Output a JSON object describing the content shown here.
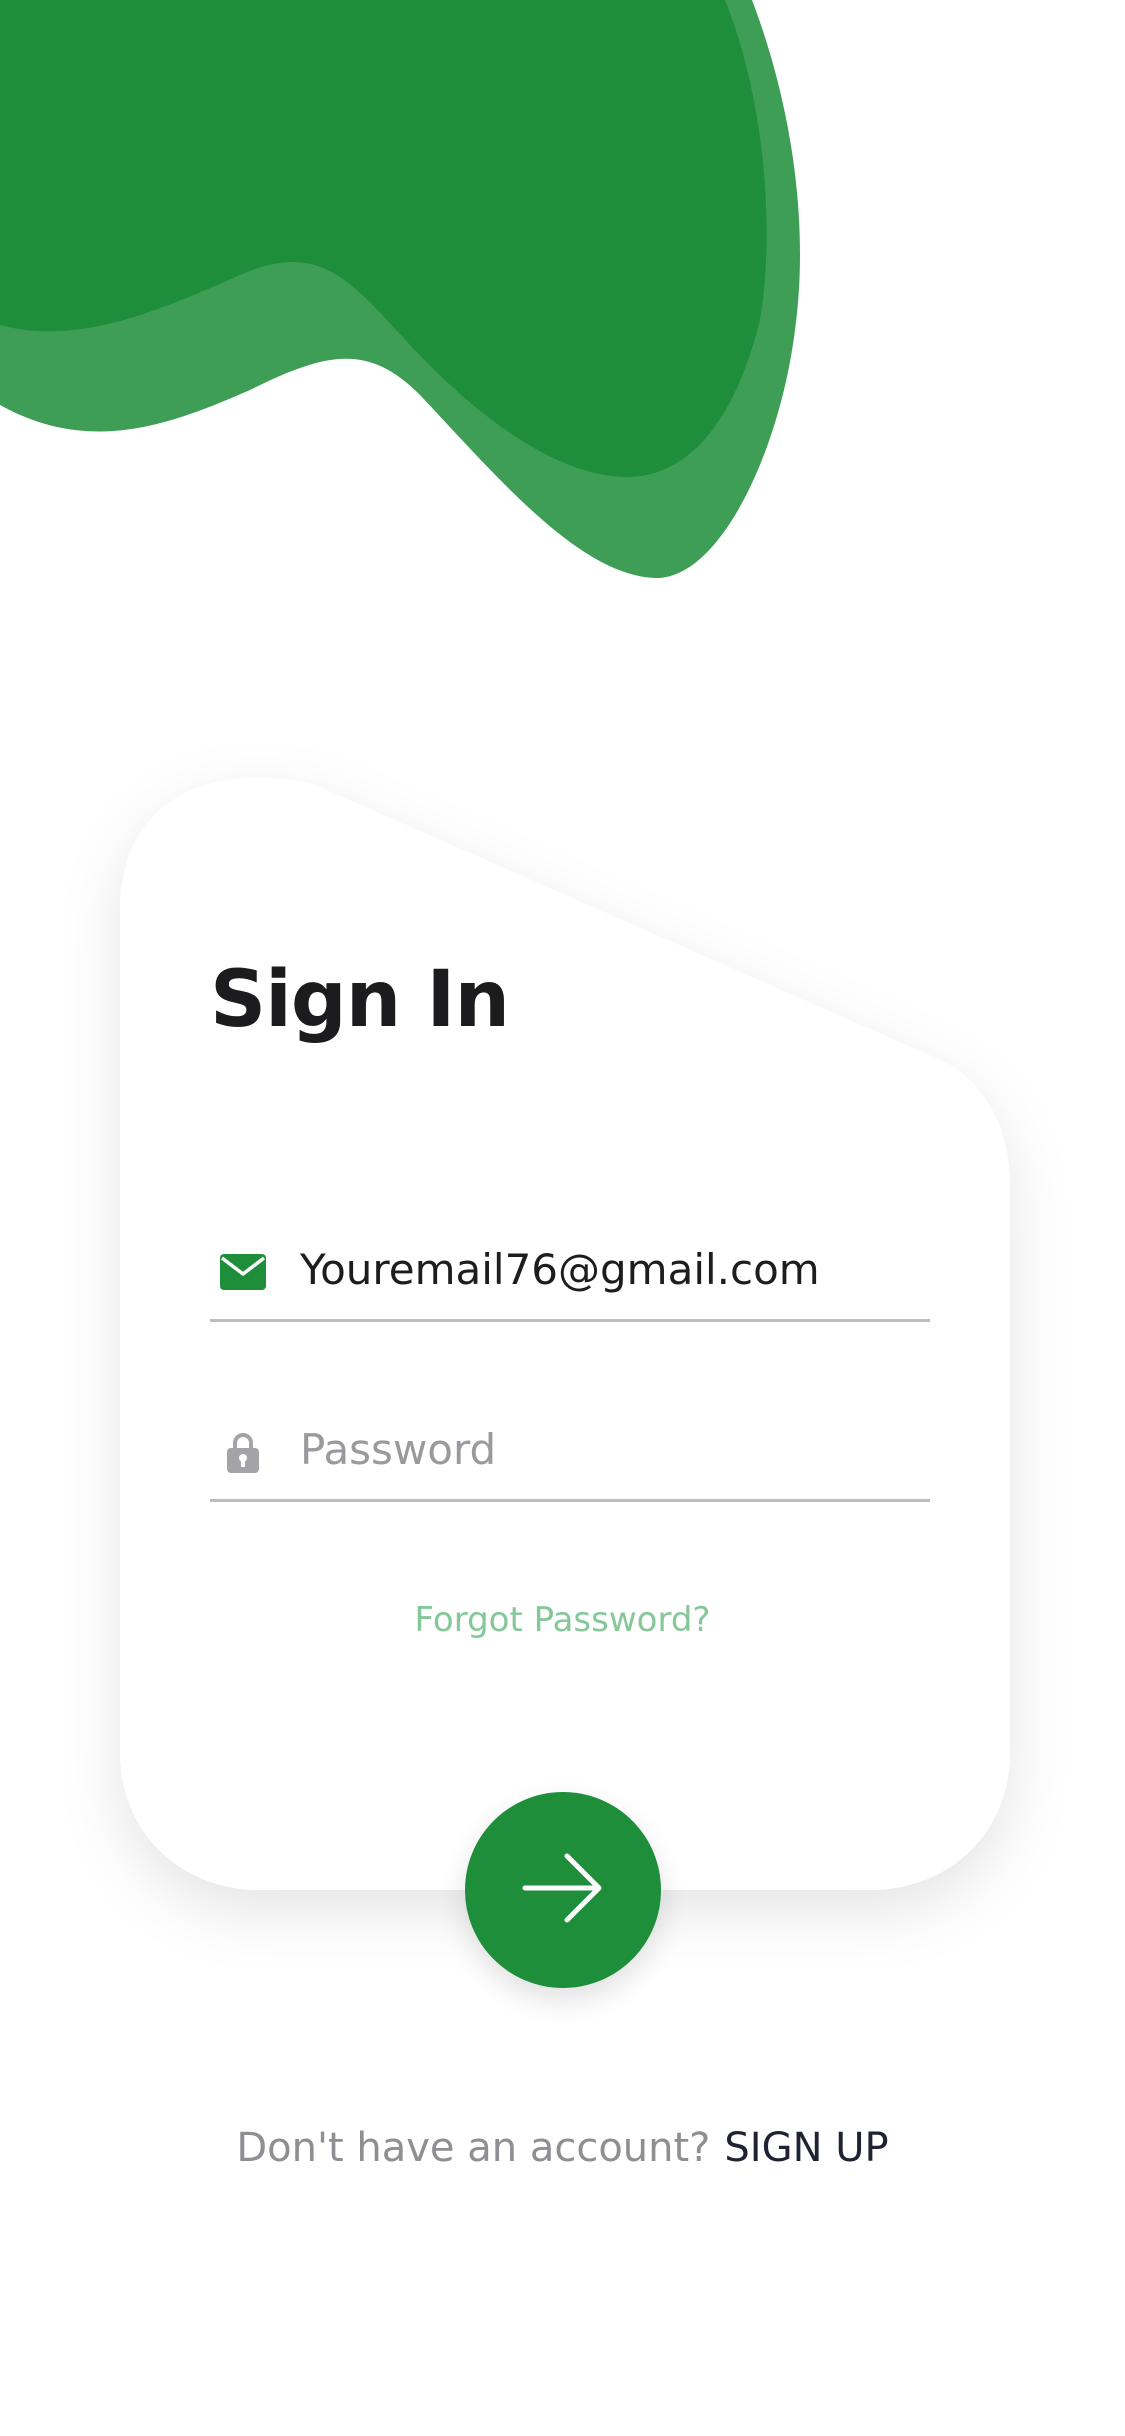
{
  "colors": {
    "brand_green": "#1e8e3a",
    "brand_green_light": "#3f9e55",
    "forgot_link": "#86c79a",
    "title": "#1c1c1e",
    "muted": "#8e8e93"
  },
  "signin": {
    "title": "Sign In",
    "email": {
      "icon": "envelope-icon",
      "value": "Youremail76@gmail.com"
    },
    "password": {
      "icon": "lock-icon",
      "placeholder": "Password"
    },
    "forgot_label": "Forgot Password?",
    "submit_icon": "arrow-right-icon"
  },
  "footer": {
    "prompt": "Don't have an account?",
    "signup_label": "SIGN UP"
  }
}
